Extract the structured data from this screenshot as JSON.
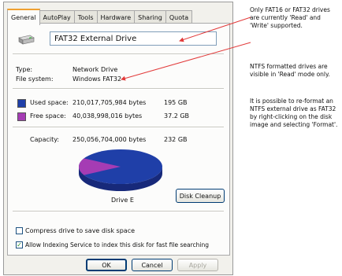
{
  "tabs": [
    {
      "label": "General",
      "active": true
    },
    {
      "label": "AutoPlay",
      "active": false
    },
    {
      "label": "Tools",
      "active": false
    },
    {
      "label": "Hardware",
      "active": false
    },
    {
      "label": "Sharing",
      "active": false
    },
    {
      "label": "Quota",
      "active": false
    }
  ],
  "drive": {
    "name": "FAT32 External Drive",
    "type_label": "Type:",
    "type_value": "Network Drive",
    "fs_label": "File system:",
    "fs_value": "Windows FAT32",
    "label": "Drive E"
  },
  "space": {
    "used": {
      "label": "Used space:",
      "bytes": "210,017,705,984 bytes",
      "gb": "195 GB",
      "color": "#1f3fa8"
    },
    "free": {
      "label": "Free space:",
      "bytes": "40,038,998,016 bytes",
      "gb": "37.2 GB",
      "color": "#a53cb4"
    },
    "capacity": {
      "label": "Capacity:",
      "bytes": "250,056,704,000 bytes",
      "gb": "232 GB"
    },
    "used_fraction": 0.84
  },
  "buttons": {
    "disk_cleanup": "Disk Cleanup",
    "ok": "OK",
    "cancel": "Cancel",
    "apply": "Apply"
  },
  "options": {
    "compress": {
      "label": "Compress drive to save disk space",
      "checked": false
    },
    "indexing": {
      "label": "Allow Indexing Service to index this disk for fast file searching",
      "checked": true
    }
  },
  "annotations": [
    "Only FAT16 or FAT32 drives are currently 'Read' and 'Write' supported.",
    "NTFS formatted drives are visible in 'Read' mode only.",
    "It is possible to re-format an NTFS external drive as FAT32 by right-clicking on the disk image and selecting 'Format'."
  ],
  "colors": {
    "arrow": "#e23a3a",
    "accent_tab": "#f0a030"
  }
}
